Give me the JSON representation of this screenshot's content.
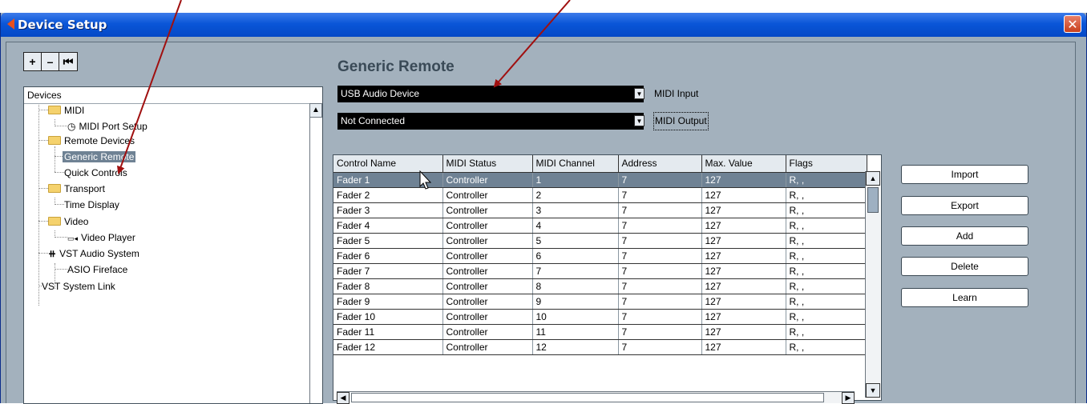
{
  "window": {
    "title": "Device Setup",
    "close_glyph": "✕",
    "accent": "#0a56d8"
  },
  "toolbar": {
    "add_label": "+",
    "remove_label": "–",
    "reset_label": "⏮"
  },
  "tree": {
    "header": "Devices",
    "scroll_up_glyph": "▲",
    "items": [
      {
        "label": "MIDI",
        "icon": "folder-icon"
      },
      {
        "label": "MIDI Port Setup",
        "icon": "midi-port-icon"
      },
      {
        "label": "Remote Devices",
        "icon": "folder-icon"
      },
      {
        "label": "Generic Remote",
        "icon": "none",
        "selected": true
      },
      {
        "label": "Quick Controls",
        "icon": "none"
      },
      {
        "label": "Transport",
        "icon": "folder-icon"
      },
      {
        "label": "Time Display",
        "icon": "none"
      },
      {
        "label": "Video",
        "icon": "folder-icon"
      },
      {
        "label": "Video Player",
        "icon": "video-player-icon"
      },
      {
        "label": "VST Audio System",
        "icon": "vst-audio-icon"
      },
      {
        "label": "ASIO Fireface",
        "icon": "none"
      },
      {
        "label": "VST System Link",
        "icon": "none"
      }
    ]
  },
  "panel": {
    "title": "Generic Remote",
    "midi_input": {
      "value": "USB Audio Device",
      "label": "MIDI Input"
    },
    "midi_output": {
      "value": "Not Connected",
      "label": "MIDI Output"
    },
    "dropdown_arrow": "▼"
  },
  "table": {
    "columns": [
      "Control Name",
      "MIDI Status",
      "MIDI Channel",
      "Address",
      "Max. Value",
      "Flags"
    ],
    "rows": [
      [
        "Fader 1",
        "Controller",
        "1",
        "7",
        "127",
        "R, ,"
      ],
      [
        "Fader 2",
        "Controller",
        "2",
        "7",
        "127",
        "R, ,"
      ],
      [
        "Fader 3",
        "Controller",
        "3",
        "7",
        "127",
        "R, ,"
      ],
      [
        "Fader 4",
        "Controller",
        "4",
        "7",
        "127",
        "R, ,"
      ],
      [
        "Fader 5",
        "Controller",
        "5",
        "7",
        "127",
        "R, ,"
      ],
      [
        "Fader 6",
        "Controller",
        "6",
        "7",
        "127",
        "R, ,"
      ],
      [
        "Fader 7",
        "Controller",
        "7",
        "7",
        "127",
        "R, ,"
      ],
      [
        "Fader 8",
        "Controller",
        "8",
        "7",
        "127",
        "R, ,"
      ],
      [
        "Fader 9",
        "Controller",
        "9",
        "7",
        "127",
        "R, ,"
      ],
      [
        "Fader 10",
        "Controller",
        "10",
        "7",
        "127",
        "R, ,"
      ],
      [
        "Fader 11",
        "Controller",
        "11",
        "7",
        "127",
        "R, ,"
      ],
      [
        "Fader 12",
        "Controller",
        "12",
        "7",
        "127",
        "R, ,"
      ]
    ],
    "selected_row": 0,
    "scroll_up": "▲",
    "scroll_down": "▼",
    "scroll_left": "◀",
    "scroll_right": "▶"
  },
  "actions": {
    "import_label": "Import",
    "export_label": "Export",
    "add_label": "Add",
    "delete_label": "Delete",
    "learn_label": "Learn"
  },
  "annotation": {
    "arrow_color": "#a01010"
  }
}
